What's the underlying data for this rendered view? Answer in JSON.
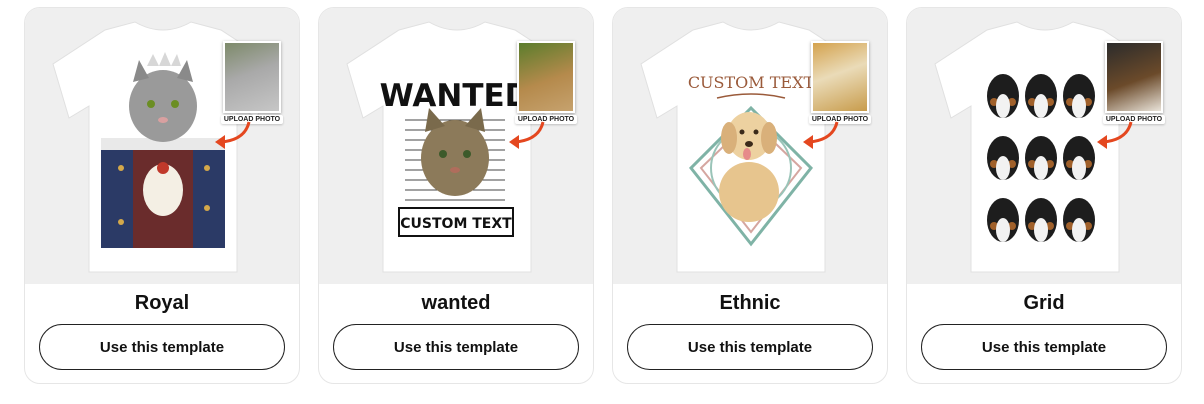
{
  "colors": {
    "media_bg": "#efefef",
    "shirt": "#ffffff",
    "arrow": "#e4471f",
    "button_border": "#222222"
  },
  "cards": [
    {
      "title": "Royal",
      "button_label": "Use this template",
      "upload_label": "UPLOAD PHOTO",
      "pet": "cat-portrait",
      "design": "royal-king-cat"
    },
    {
      "title": "wanted",
      "button_label": "Use this template",
      "upload_label": "UPLOAD PHOTO",
      "pet": "cat-portrait",
      "design": "wanted-poster",
      "design_text": {
        "headline": "WANTED",
        "custom": "CUSTOM TEXT"
      }
    },
    {
      "title": "Ethnic",
      "button_label": "Use this template",
      "upload_label": "UPLOAD PHOTO",
      "pet": "dog-portrait",
      "design": "ethnic-mandala-dog",
      "design_text": {
        "custom": "CUSTOM TEXT"
      }
    },
    {
      "title": "Grid",
      "button_label": "Use this template",
      "upload_label": "UPLOAD PHOTO",
      "pet": "puppy-portrait",
      "design": "grid-3x3-puppies"
    }
  ]
}
